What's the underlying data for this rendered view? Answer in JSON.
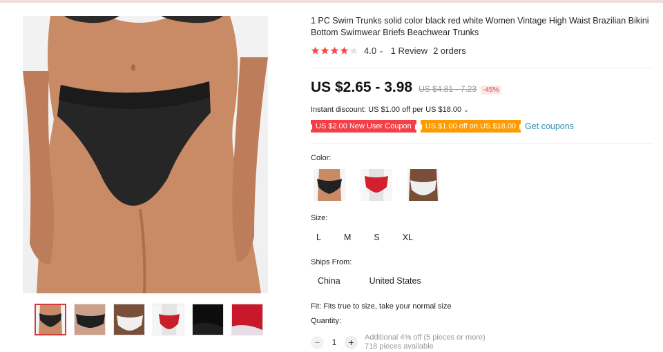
{
  "product": {
    "title": "1 PC Swim Trunks solid color black red white Women Vintage High Waist Brazilian Bikini Bottom Swimwear Briefs Beachwear Trunks",
    "rating": {
      "stars": 4.0,
      "score": "4.0",
      "reviews": "1 Review",
      "orders": "2 orders"
    },
    "price": "US $2.65 - 3.98",
    "old_price": "US $4.81 - 7.23",
    "discount": "-45%",
    "instant_discount": "Instant discount: US $1.00 off per US $18.00",
    "coupons": [
      {
        "label": "US $2.00 New User Coupon",
        "color": "#f43f47"
      },
      {
        "label": "US $1.00 off on US $18.00",
        "color": "#ff9a00"
      }
    ],
    "get_coupons": "Get coupons",
    "color_label": "Color:",
    "color_options": [
      "black",
      "red",
      "white"
    ],
    "size_label": "Size:",
    "sizes": [
      "L",
      "M",
      "S",
      "XL"
    ],
    "ships_label": "Ships From:",
    "ships": [
      "China",
      "United States"
    ],
    "fit": "Fit: Fits true to size, take your normal size",
    "quantity_label": "Quantity:",
    "quantity": "1",
    "qty_note_1": "Additional 4% off (5 pieces or more)",
    "qty_note_2": "718 pieces available"
  },
  "colors": {
    "accent": "#f43f47",
    "star": "#f34a4a",
    "link": "#2e8fb8"
  }
}
